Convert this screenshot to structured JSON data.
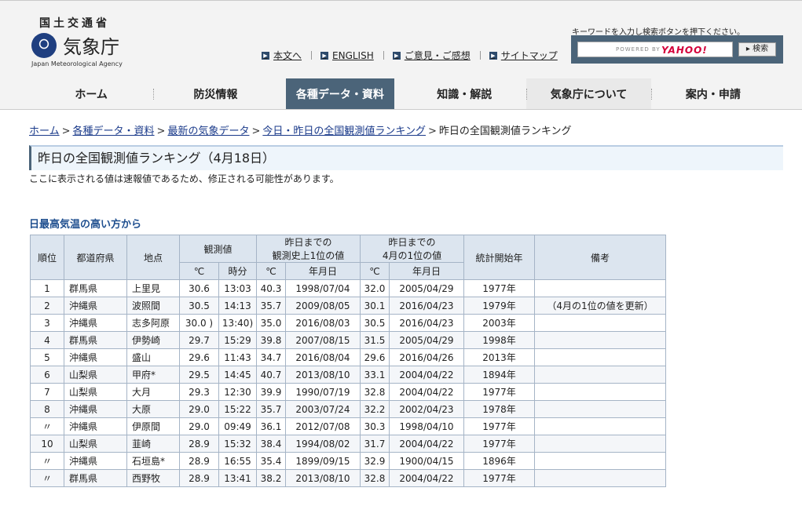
{
  "header": {
    "ministry": "国土交通省",
    "logo_mark": "〇",
    "agency_name": "気象庁",
    "agency_name_en": "Japan Meteorological Agency"
  },
  "util_links": [
    {
      "label": "本文へ"
    },
    {
      "label": "ENGLISH"
    },
    {
      "label": "ご意見・ご感想"
    },
    {
      "label": "サイトマップ"
    }
  ],
  "search": {
    "note": "キーワードを入力し検索ボタンを押下ください。",
    "placeholder": "POWERED BY",
    "yahoo": "YAHOO!",
    "button": "検索"
  },
  "nav": [
    {
      "label": "ホーム"
    },
    {
      "label": "防災情報"
    },
    {
      "label": "各種データ・資料"
    },
    {
      "label": "知識・解説"
    },
    {
      "label": "気象庁について"
    },
    {
      "label": "案内・申請"
    }
  ],
  "breadcrumb": [
    {
      "label": "ホーム"
    },
    {
      "label": "各種データ・資料"
    },
    {
      "label": "最新の気象データ"
    },
    {
      "label": "今日・昨日の全国観測値ランキング"
    },
    {
      "label": "昨日の全国観測値ランキング"
    }
  ],
  "page": {
    "title": "昨日の全国観測値ランキング（4月18日）",
    "notice": "ここに表示される値は速報値であるため、修正される可能性があります。",
    "section_title": "日最高気温の高い方から"
  },
  "table": {
    "headers": {
      "rank": "順位",
      "pref": "都道府県",
      "place": "地点",
      "observed": "観測値",
      "record_l1": "昨日までの",
      "record_l2": "観測史上1位の値",
      "april_l1": "昨日までの",
      "april_l2": "4月の1位の値",
      "start": "統計開始年",
      "note": "備考"
    },
    "subheaders": {
      "c1": "℃",
      "time": "時分",
      "c2": "℃",
      "date1": "年月日",
      "c3": "℃",
      "date2": "年月日"
    },
    "rows": [
      {
        "rank": "1",
        "pref": "群馬県",
        "place": "上里見",
        "temp": "30.6",
        "time": "13:03",
        "rec_temp": "40.3",
        "rec_date": "1998/07/04",
        "apr_temp": "32.0",
        "apr_date": "2005/04/29",
        "start": "1977年",
        "note": ""
      },
      {
        "rank": "2",
        "pref": "沖縄県",
        "place": "波照間",
        "temp": "30.5",
        "time": "14:13",
        "rec_temp": "35.7",
        "rec_date": "2009/08/05",
        "apr_temp": "30.1",
        "apr_date": "2016/04/23",
        "start": "1979年",
        "note": "（4月の1位の値を更新）"
      },
      {
        "rank": "3",
        "pref": "沖縄県",
        "place": "志多阿原",
        "temp": "30.0 )",
        "time": "13:40)",
        "rec_temp": "35.0",
        "rec_date": "2016/08/03",
        "apr_temp": "30.5",
        "apr_date": "2016/04/23",
        "start": "2003年",
        "note": ""
      },
      {
        "rank": "4",
        "pref": "群馬県",
        "place": "伊勢崎",
        "temp": "29.7",
        "time": "15:29",
        "rec_temp": "39.8",
        "rec_date": "2007/08/15",
        "apr_temp": "31.5",
        "apr_date": "2005/04/29",
        "start": "1998年",
        "note": ""
      },
      {
        "rank": "5",
        "pref": "沖縄県",
        "place": "盛山",
        "temp": "29.6",
        "time": "11:43",
        "rec_temp": "34.7",
        "rec_date": "2016/08/04",
        "apr_temp": "29.6",
        "apr_date": "2016/04/26",
        "start": "2013年",
        "note": ""
      },
      {
        "rank": "6",
        "pref": "山梨県",
        "place": "甲府*",
        "temp": "29.5",
        "time": "14:45",
        "rec_temp": "40.7",
        "rec_date": "2013/08/10",
        "apr_temp": "33.1",
        "apr_date": "2004/04/22",
        "start": "1894年",
        "note": ""
      },
      {
        "rank": "7",
        "pref": "山梨県",
        "place": "大月",
        "temp": "29.3",
        "time": "12:30",
        "rec_temp": "39.9",
        "rec_date": "1990/07/19",
        "apr_temp": "32.8",
        "apr_date": "2004/04/22",
        "start": "1977年",
        "note": ""
      },
      {
        "rank": "8",
        "pref": "沖縄県",
        "place": "大原",
        "temp": "29.0",
        "time": "15:22",
        "rec_temp": "35.7",
        "rec_date": "2003/07/24",
        "apr_temp": "32.2",
        "apr_date": "2002/04/23",
        "start": "1978年",
        "note": ""
      },
      {
        "rank": "〃",
        "pref": "沖縄県",
        "place": "伊原間",
        "temp": "29.0",
        "time": "09:49",
        "rec_temp": "36.1",
        "rec_date": "2012/07/08",
        "apr_temp": "30.3",
        "apr_date": "1998/04/10",
        "start": "1977年",
        "note": ""
      },
      {
        "rank": "10",
        "pref": "山梨県",
        "place": "韮崎",
        "temp": "28.9",
        "time": "15:32",
        "rec_temp": "38.4",
        "rec_date": "1994/08/02",
        "apr_temp": "31.7",
        "apr_date": "2004/04/22",
        "start": "1977年",
        "note": ""
      },
      {
        "rank": "〃",
        "pref": "沖縄県",
        "place": "石垣島*",
        "temp": "28.9",
        "time": "16:55",
        "rec_temp": "35.4",
        "rec_date": "1899/09/15",
        "apr_temp": "32.9",
        "apr_date": "1900/04/15",
        "start": "1896年",
        "note": ""
      },
      {
        "rank": "〃",
        "pref": "群馬県",
        "place": "西野牧",
        "temp": "28.9",
        "time": "13:41",
        "rec_temp": "38.2",
        "rec_date": "2013/08/10",
        "apr_temp": "32.8",
        "apr_date": "2004/04/22",
        "start": "1977年",
        "note": ""
      }
    ]
  }
}
